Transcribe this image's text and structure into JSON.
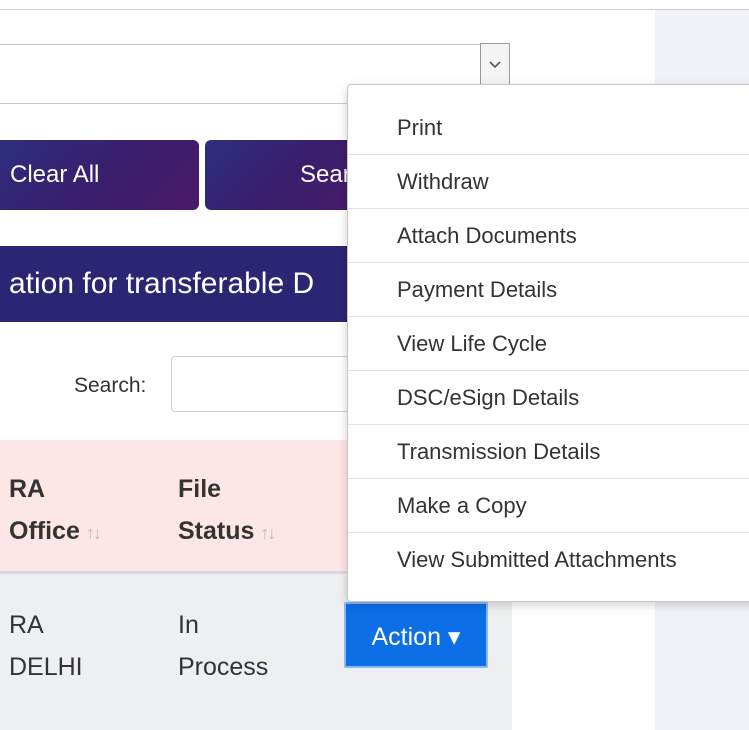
{
  "filters": {
    "select_value": "",
    "clear_label": "Clear All",
    "search_label": "Sear"
  },
  "banner": {
    "text": "ation for transferable D"
  },
  "table_search": {
    "label": "Search:",
    "value": ""
  },
  "table": {
    "headers": [
      {
        "line1": "RA",
        "line2": "Office",
        "sort": "↑↓"
      },
      {
        "line1": "File",
        "line2": "Status",
        "sort": "↑↓"
      }
    ],
    "rows": [
      {
        "ra_line1": "RA",
        "ra_line2": "DELHI",
        "status_line1": "In",
        "status_line2": "Process",
        "action_label": "Action ▾"
      }
    ]
  },
  "action_menu": {
    "items": [
      "Print",
      "Withdraw",
      "Attach Documents",
      "Payment Details",
      "View Life Cycle",
      "DSC/eSign Details",
      "Transmission Details",
      "Make a Copy",
      "View Submitted Attachments"
    ]
  },
  "colors": {
    "banner": "#2a2674",
    "button_gradient_start": "#2d2e7e",
    "button_gradient_end": "#4b1a68",
    "table_header_bg": "#fde6e6",
    "action_button": "#0d6fe6",
    "side_panel": "#f1f2f7"
  },
  "icons": {
    "select_caret": "chevron-down-icon",
    "sort": "sort-arrows-icon"
  }
}
